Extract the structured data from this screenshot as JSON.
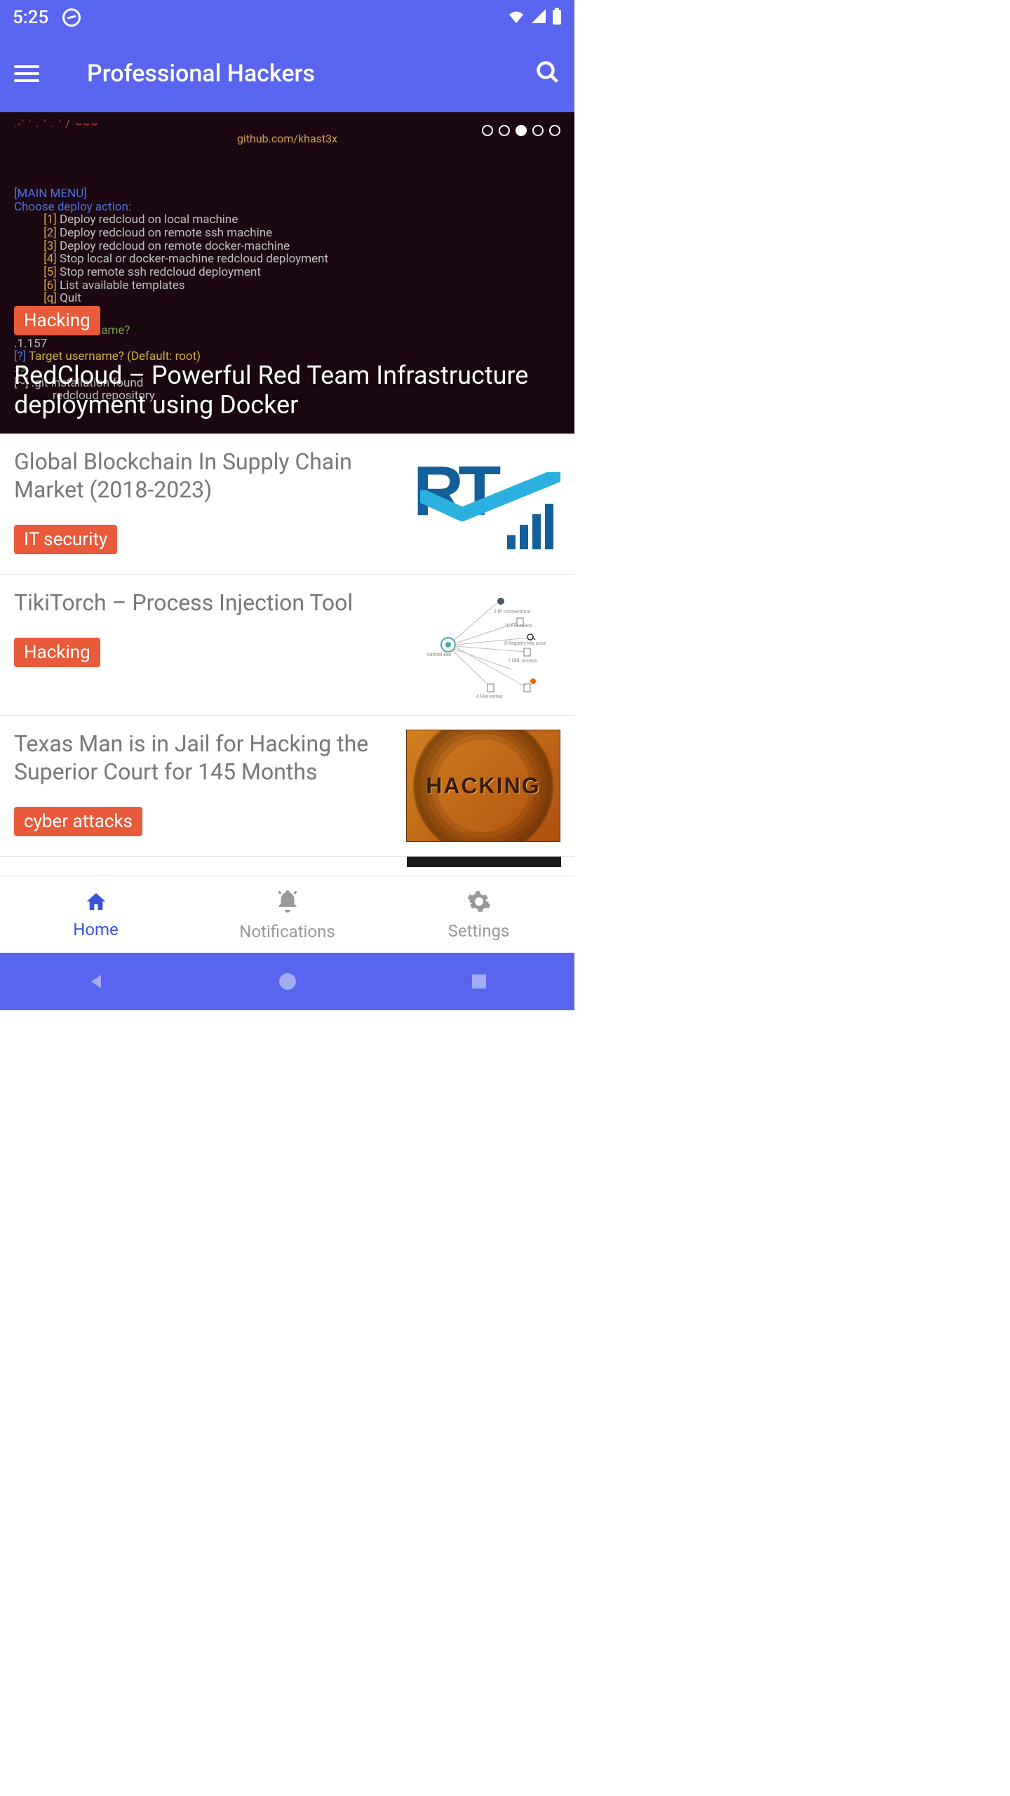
{
  "status": {
    "time": "5:25"
  },
  "app": {
    "title": "Professional Hackers"
  },
  "hero": {
    "url": "github.com/khast3x",
    "tag": "Hacking",
    "title": "RedCloud – Powerful Red Team Infrastructure deployment using Docker",
    "menu_header": "[MAIN MENU]",
    "menu_prompt": "Choose deploy action:",
    "items": [
      "Deploy redcloud on local machine",
      "Deploy redcloud on remote ssh machine",
      "Deploy redcloud on remote docker-machine",
      "Stop local or docker-machine redcloud deployment",
      "Stop remote ssh redcloud deployment",
      "List available templates",
      "Quit"
    ],
    "p_ip": "IP or hostname?",
    "p_ip_val": ".1.157",
    "p_user": "Target username? (Default: root)",
    "p_git1": ".git installation found",
    "p_git2": "redcloud repository",
    "carousel": {
      "total": 5,
      "active_index": 2
    }
  },
  "articles": [
    {
      "title": "Global Blockchain In Supply Chain Market (2018-2023)",
      "tag": "IT security",
      "thumb": "rt"
    },
    {
      "title": "TikiTorch – Process Injection Tool",
      "tag": "Hacking",
      "thumb": "graph"
    },
    {
      "title": "Texas Man is in Jail for Hacking the Superior Court for 145 Months",
      "tag": "cyber attacks",
      "thumb": "hacking"
    }
  ],
  "bottom_nav": [
    {
      "label": "Home",
      "icon": "home",
      "active": true
    },
    {
      "label": "Notifications",
      "icon": "bell",
      "active": false
    },
    {
      "label": "Settings",
      "icon": "gear",
      "active": false
    }
  ]
}
